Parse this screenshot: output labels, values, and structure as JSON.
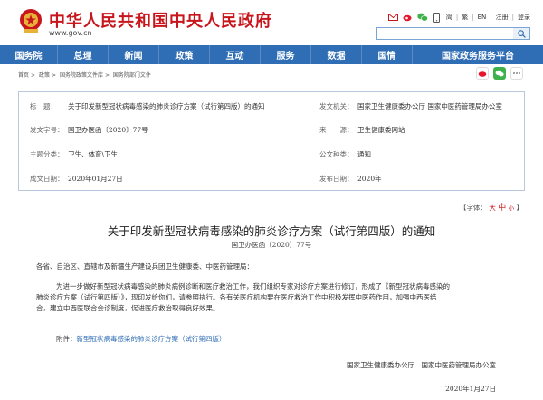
{
  "header": {
    "site_title": "中华人民共和国中央人民政府",
    "site_url": "www.gov.cn",
    "util_links": [
      "简",
      "繁",
      "EN",
      "注册",
      "登录"
    ]
  },
  "nav": {
    "items": [
      "国务院",
      "总理",
      "新闻",
      "政策",
      "互动",
      "服务",
      "数据",
      "国情",
      "国家政务服务平台"
    ]
  },
  "breadcrumb": {
    "items": [
      "首页",
      "政策",
      "国务院政策文件库",
      "国务院部门文件"
    ]
  },
  "info": {
    "title_label": "标　题：",
    "title_value": "关于印发新型冠状病毒感染的肺炎诊疗方案（试行第四版）的通知",
    "agency_label": "发文机关：",
    "agency_value": "国家卫生健康委办公厅 国家中医药管理局办公室",
    "docno_label": "发文字号：",
    "docno_value": "国卫办医函〔2020〕77号",
    "source_label": "来　　源：",
    "source_value": "卫生健康委网站",
    "topic_label": "主题分类：",
    "topic_value": "卫生、体育\\卫生",
    "type_label": "公文种类：",
    "type_value": "通知",
    "written_label": "成文日期：",
    "written_value": "2020年01月27日",
    "published_label": "发布日期：",
    "published_value": "2020年"
  },
  "fontsize": {
    "prefix": "【字体：",
    "large": "大",
    "medium": "中",
    "small": "小",
    "suffix": "】"
  },
  "doc": {
    "title": "关于印发新型冠状病毒感染的肺炎诊疗方案（试行第四版）的通知",
    "number": "国卫办医函〔2020〕77号",
    "salutation": "各省、自治区、直辖市及新疆生产建设兵团卫生健康委、中医药管理局：",
    "para_line1": "为进一步做好新型冠状病毒感染的肺炎病例诊断和医疗救治工作，我们组织专家对诊疗方案进行修订，形成了《新型冠状病毒感染的",
    "para_line2": "肺炎诊疗方案（试行第四版）》，现印发给你们，请参照执行。各有关医疗机构要在医疗救治工作中积极发挥中医药作用，加强中西医结",
    "para_line3": "合，建立中西医联合会诊制度，促进医疗救治取得良好效果。",
    "attach_label": "附件：",
    "attach_link": "新型冠状病毒感染的肺炎诊疗方案（试行第四版）",
    "signature": "国家卫生健康委办公厅　国家中医药管理局办公室",
    "date": "2020年1月27日"
  },
  "colors": {
    "brand_red": "#c8161d",
    "nav_blue": "#2f6db5",
    "link_blue": "#2f6db5"
  },
  "icons": [
    "national-emblem-icon",
    "email-icon",
    "weibo-icon",
    "wechat-icon",
    "mobile-icon",
    "search-icon",
    "share-weibo-icon",
    "share-wechat-icon",
    "share-more-icon"
  ]
}
